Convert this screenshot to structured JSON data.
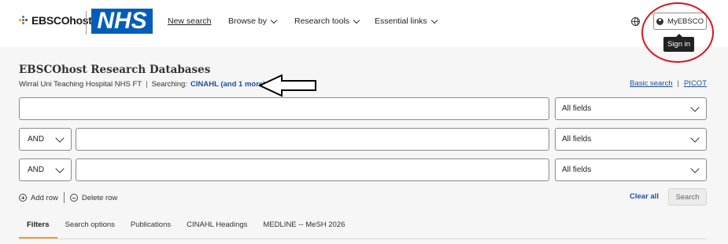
{
  "header": {
    "brand_text": "EBSCOhost",
    "partner_logo_text": "NHS",
    "nav": {
      "new_search": "New search",
      "browse_by": "Browse by",
      "research_tools": "Research tools",
      "essential_links": "Essential links"
    },
    "account_button": "MyEBSCO",
    "tooltip": "Sign in"
  },
  "main": {
    "title": "EBSCOhost Research Databases",
    "institution": "Wirral Uni Teaching Hospital NHS FT",
    "separator": "|",
    "searching_label": "Searching:",
    "databases_link": "CINAHL (and 1 more)",
    "basic_search": "Basic search",
    "picot": "PICOT",
    "rows": [
      {
        "boolean": "",
        "field": "All fields"
      },
      {
        "boolean": "AND",
        "field": "All fields"
      },
      {
        "boolean": "AND",
        "field": "All fields"
      }
    ],
    "add_row": "Add row",
    "delete_row": "Delete row",
    "clear_all": "Clear all",
    "search_button": "Search"
  },
  "tabs": [
    "Filters",
    "Search options",
    "Publications",
    "CINAHL Headings",
    "MEDLINE -- MeSH 2026"
  ],
  "colors": {
    "nhs_blue": "#005eb8",
    "link_blue": "#1a4f9c",
    "annotation_red": "#e0141e",
    "active_tab_underline": "#f0a020"
  }
}
